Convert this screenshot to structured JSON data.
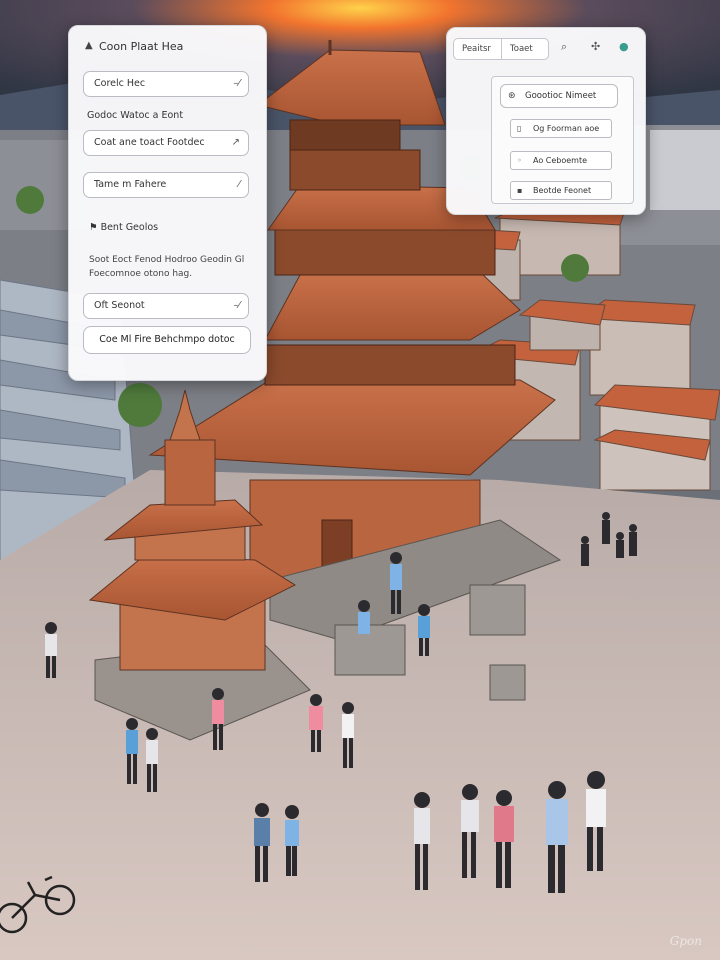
{
  "left_panel": {
    "title": "Coon Plaat Hea",
    "field_1": {
      "value": "Corelc Hec",
      "icon": "dash-icon"
    },
    "section_label": "Godoc Watoc a Eont",
    "field_2": {
      "value": "Coat ane toact Footdec",
      "icon": "arrow-icon"
    },
    "field_3": {
      "value": "Tame m Fahere",
      "icon": "slash-icon"
    },
    "section_heading": "Bent Geolos",
    "body_text": "Soot Eoct Fenod Hodroo Geodin Gl Foecomnoe otono hag.",
    "field_4": {
      "value": "Oft Seonot",
      "icon": "dash-icon"
    },
    "button_label": "Coe Ml Fire Behchmpo dotoc"
  },
  "right_panel": {
    "tab_1": "Peaitsr",
    "tab_2": "Toaet",
    "header": "Goootioc Nimeet",
    "items": [
      "Og Foorman aoe",
      "Ao Ceboemte",
      "Beotde Feonet"
    ]
  },
  "watermark": "Gpon"
}
